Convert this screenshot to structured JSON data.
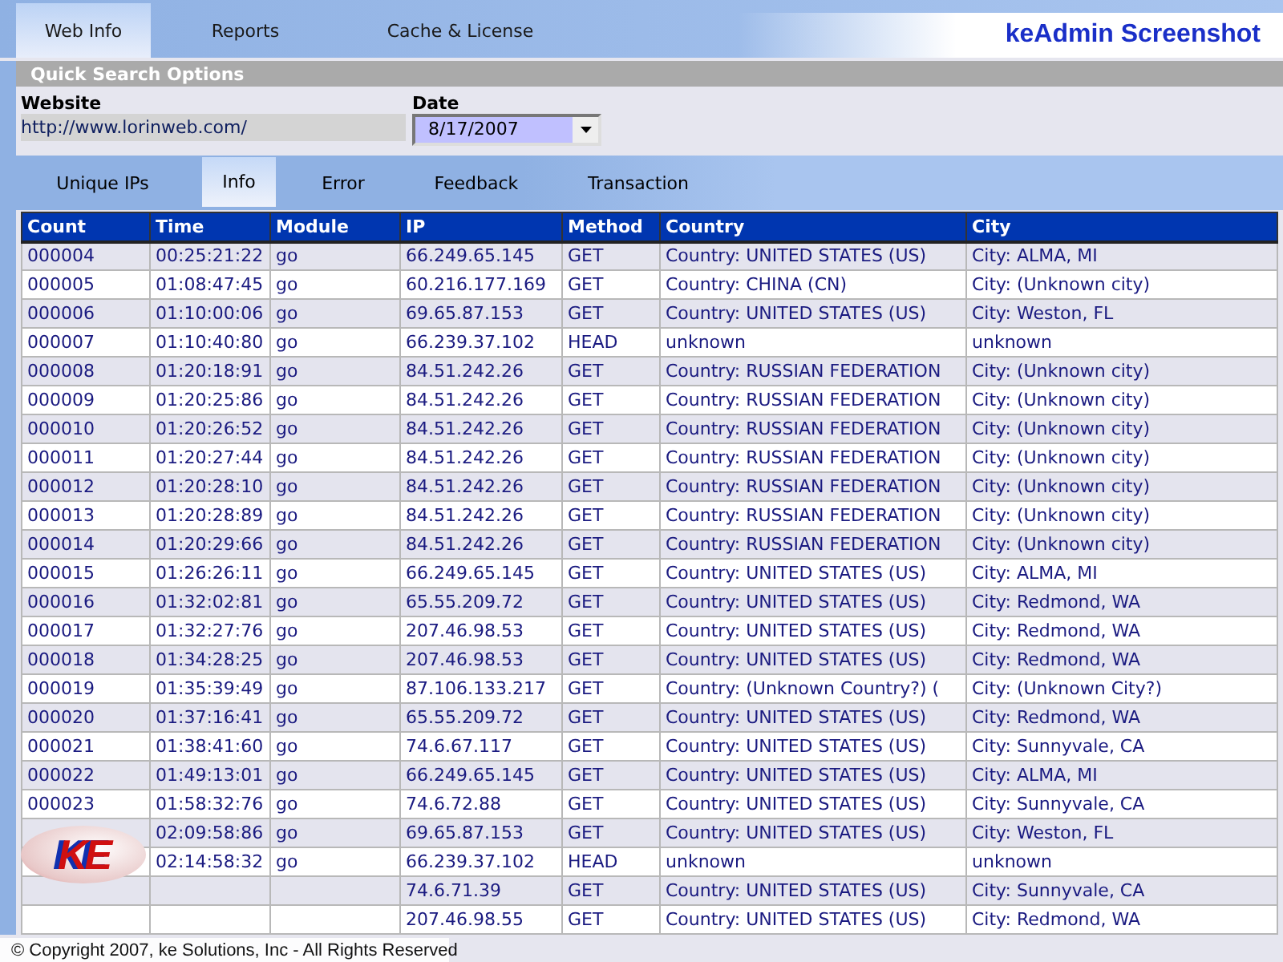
{
  "top_tabs": [
    {
      "label": "Web Info",
      "selected": true
    },
    {
      "label": "Reports",
      "selected": false
    },
    {
      "label": "Cache & License",
      "selected": false
    }
  ],
  "app_title": "keAdmin Screenshot",
  "quick_search": {
    "title": "Quick Search Options",
    "website_label": "Website",
    "website_value": "http://www.lorinweb.com/",
    "date_label": "Date",
    "date_value": "8/17/2007"
  },
  "sub_tabs": [
    {
      "label": "Unique IPs",
      "selected": false
    },
    {
      "label": "Info",
      "selected": true
    },
    {
      "label": "Error",
      "selected": false
    },
    {
      "label": "Feedback",
      "selected": false
    },
    {
      "label": "Transaction",
      "selected": false
    }
  ],
  "table": {
    "columns": [
      "Count",
      "Time",
      "Module",
      "IP",
      "Method",
      "Country",
      "City"
    ],
    "rows": [
      [
        "000004",
        "00:25:21:22",
        "go",
        "66.249.65.145",
        "GET",
        "Country: UNITED STATES (US)",
        "City: ALMA, MI"
      ],
      [
        "000005",
        "01:08:47:45",
        "go",
        "60.216.177.169",
        "GET",
        "Country: CHINA (CN)",
        "City: (Unknown city)"
      ],
      [
        "000006",
        "01:10:00:06",
        "go",
        "69.65.87.153",
        "GET",
        "Country: UNITED STATES (US)",
        "City: Weston, FL"
      ],
      [
        "000007",
        "01:10:40:80",
        "go",
        "66.239.37.102",
        "HEAD",
        "unknown",
        "unknown"
      ],
      [
        "000008",
        "01:20:18:91",
        "go",
        "84.51.242.26",
        "GET",
        "Country: RUSSIAN FEDERATION",
        "City: (Unknown city)"
      ],
      [
        "000009",
        "01:20:25:86",
        "go",
        "84.51.242.26",
        "GET",
        "Country: RUSSIAN FEDERATION",
        "City: (Unknown city)"
      ],
      [
        "000010",
        "01:20:26:52",
        "go",
        "84.51.242.26",
        "GET",
        "Country: RUSSIAN FEDERATION",
        "City: (Unknown city)"
      ],
      [
        "000011",
        "01:20:27:44",
        "go",
        "84.51.242.26",
        "GET",
        "Country: RUSSIAN FEDERATION",
        "City: (Unknown city)"
      ],
      [
        "000012",
        "01:20:28:10",
        "go",
        "84.51.242.26",
        "GET",
        "Country: RUSSIAN FEDERATION",
        "City: (Unknown city)"
      ],
      [
        "000013",
        "01:20:28:89",
        "go",
        "84.51.242.26",
        "GET",
        "Country: RUSSIAN FEDERATION",
        "City: (Unknown city)"
      ],
      [
        "000014",
        "01:20:29:66",
        "go",
        "84.51.242.26",
        "GET",
        "Country: RUSSIAN FEDERATION",
        "City: (Unknown city)"
      ],
      [
        "000015",
        "01:26:26:11",
        "go",
        "66.249.65.145",
        "GET",
        "Country: UNITED STATES (US)",
        "City: ALMA, MI"
      ],
      [
        "000016",
        "01:32:02:81",
        "go",
        "65.55.209.72",
        "GET",
        "Country: UNITED STATES (US)",
        "City: Redmond, WA"
      ],
      [
        "000017",
        "01:32:27:76",
        "go",
        "207.46.98.53",
        "GET",
        "Country: UNITED STATES (US)",
        "City: Redmond, WA"
      ],
      [
        "000018",
        "01:34:28:25",
        "go",
        "207.46.98.53",
        "GET",
        "Country: UNITED STATES (US)",
        "City: Redmond, WA"
      ],
      [
        "000019",
        "01:35:39:49",
        "go",
        "87.106.133.217",
        "GET",
        "Country: (Unknown Country?) (",
        "City: (Unknown City?)"
      ],
      [
        "000020",
        "01:37:16:41",
        "go",
        "65.55.209.72",
        "GET",
        "Country: UNITED STATES (US)",
        "City: Redmond, WA"
      ],
      [
        "000021",
        "01:38:41:60",
        "go",
        "74.6.67.117",
        "GET",
        "Country: UNITED STATES (US)",
        "City: Sunnyvale, CA"
      ],
      [
        "000022",
        "01:49:13:01",
        "go",
        "66.249.65.145",
        "GET",
        "Country: UNITED STATES (US)",
        "City: ALMA, MI"
      ],
      [
        "000023",
        "01:58:32:76",
        "go",
        "74.6.72.88",
        "GET",
        "Country: UNITED STATES (US)",
        "City: Sunnyvale, CA"
      ],
      [
        "",
        "02:09:58:86",
        "go",
        "69.65.87.153",
        "GET",
        "Country: UNITED STATES (US)",
        "City: Weston, FL"
      ],
      [
        "",
        "02:14:58:32",
        "go",
        "66.239.37.102",
        "HEAD",
        "unknown",
        "unknown"
      ],
      [
        "",
        "",
        "",
        "74.6.71.39",
        "GET",
        "Country: UNITED STATES (US)",
        "City: Sunnyvale, CA"
      ],
      [
        "",
        "",
        "",
        "207.46.98.55",
        "GET",
        "Country: UNITED STATES (US)",
        "City: Redmond, WA"
      ]
    ]
  },
  "footer": {
    "copyright": "© Copyright 2007, ke Solutions, Inc - All Rights Reserved",
    "logo_text": "KE"
  }
}
